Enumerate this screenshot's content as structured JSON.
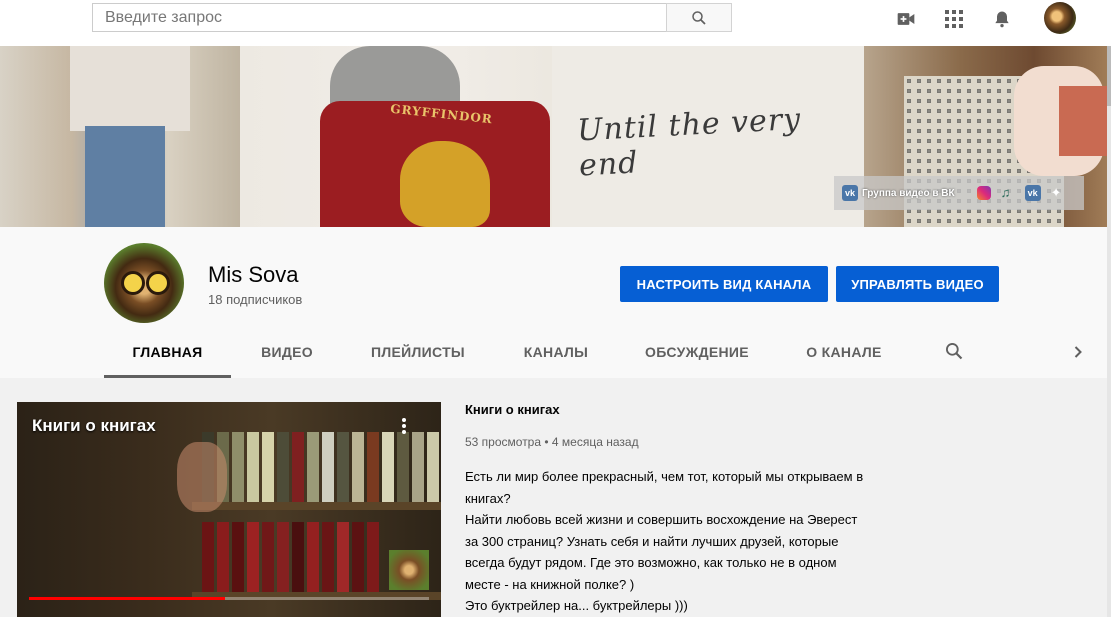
{
  "search": {
    "placeholder": "Введите запрос"
  },
  "topbar_icons": [
    "video-camera-add-icon",
    "apps-grid-icon",
    "notifications-bell-icon"
  ],
  "banner": {
    "script_text": "Until the very end",
    "jacket_text": "GRYFFINDOR",
    "links": [
      {
        "icon": "vk-icon",
        "label": "Группа видео в ВК"
      },
      {
        "icon": "instagram-icon",
        "label": ""
      },
      {
        "icon": "music-icon",
        "label": ""
      },
      {
        "icon": "vk-icon",
        "label": ""
      },
      {
        "icon": "plus-icon",
        "label": ""
      }
    ]
  },
  "channel": {
    "name": "Mis Sova",
    "subscribers": "18 подписчиков",
    "customize_label": "НАСТРОИТЬ ВИД КАНАЛА",
    "manage_label": "УПРАВЛЯТЬ ВИДЕО"
  },
  "tabs": [
    {
      "label": "ГЛАВНАЯ",
      "active": true
    },
    {
      "label": "ВИДЕО",
      "active": false
    },
    {
      "label": "ПЛЕЙЛИСТЫ",
      "active": false
    },
    {
      "label": "КАНАЛЫ",
      "active": false
    },
    {
      "label": "ОБСУЖДЕНИЕ",
      "active": false
    },
    {
      "label": "О КАНАЛЕ",
      "active": false
    }
  ],
  "featured_video": {
    "thumbnail_title": "Книги о книгах",
    "title": "Книги о книгах",
    "views": "53 просмотра",
    "separator": "•",
    "age": "4 месяца назад",
    "progress": 0.49,
    "description": "Есть ли мир более прекрасный, чем тот, который мы открываем в книгах?\nНайти любовь всей жизни и совершить восхождение на Эверест за 300 страниц? Узнать себя и найти лучших друзей, которые всегда будут рядом. Где это возможно, как только не в одном месте - на книжной полке? )\nЭто буктрейлер на... буктрейлеры )))"
  },
  "colors": {
    "accent": "#065fd4",
    "progress": "#ff0000",
    "vk": "#4a76a8"
  }
}
